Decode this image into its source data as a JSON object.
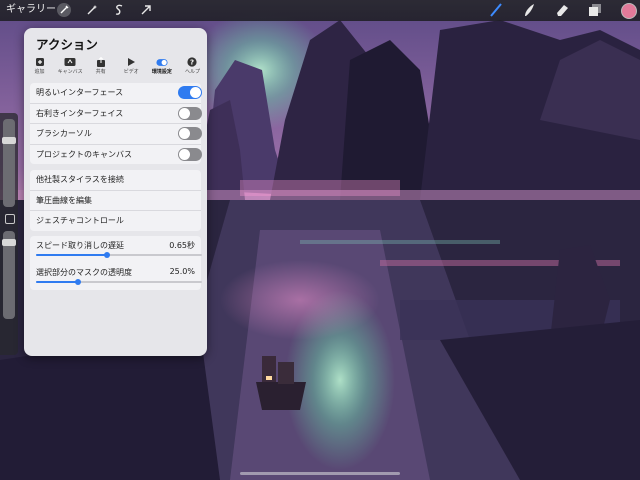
{
  "toolbar": {
    "gallery_label": "ギャラリー",
    "left_icons": [
      "wrench-icon",
      "magic-wand-icon",
      "selection-s-icon",
      "transform-arrow-icon"
    ],
    "right_icons": [
      "brush-icon",
      "smudge-icon",
      "eraser-icon",
      "layers-icon"
    ],
    "color_swatch": "#e27a9a"
  },
  "sidebar": {
    "size_slider_level": 0.78,
    "opacity_slider_level": 0.9
  },
  "panel": {
    "title": "アクション",
    "tabs": [
      {
        "label": "追加",
        "icon": "add-icon"
      },
      {
        "label": "キャンバス",
        "icon": "canvas-icon"
      },
      {
        "label": "共有",
        "icon": "share-icon"
      },
      {
        "label": "ビデオ",
        "icon": "video-icon"
      },
      {
        "label": "環境設定",
        "icon": "prefs-toggle-icon",
        "active": true
      },
      {
        "label": "ヘルプ",
        "icon": "help-icon"
      }
    ],
    "toggles": [
      {
        "label": "明るいインターフェース",
        "on": true
      },
      {
        "label": "右利きインターフェイス",
        "on": false
      },
      {
        "label": "ブラシカーソル",
        "on": false
      },
      {
        "label": "プロジェクトのキャンバス",
        "on": false
      }
    ],
    "links": [
      "他社製スタイラスを接続",
      "筆圧曲線を編集",
      "ジェスチャコントロール"
    ],
    "sliders": [
      {
        "label": "スピード取り消しの遅延",
        "value": "0.65秒",
        "level": 0.43
      },
      {
        "label": "選択部分のマスクの透明度",
        "value": "25.0%",
        "level": 0.25
      }
    ],
    "accent_color": "#2f7bf0"
  }
}
